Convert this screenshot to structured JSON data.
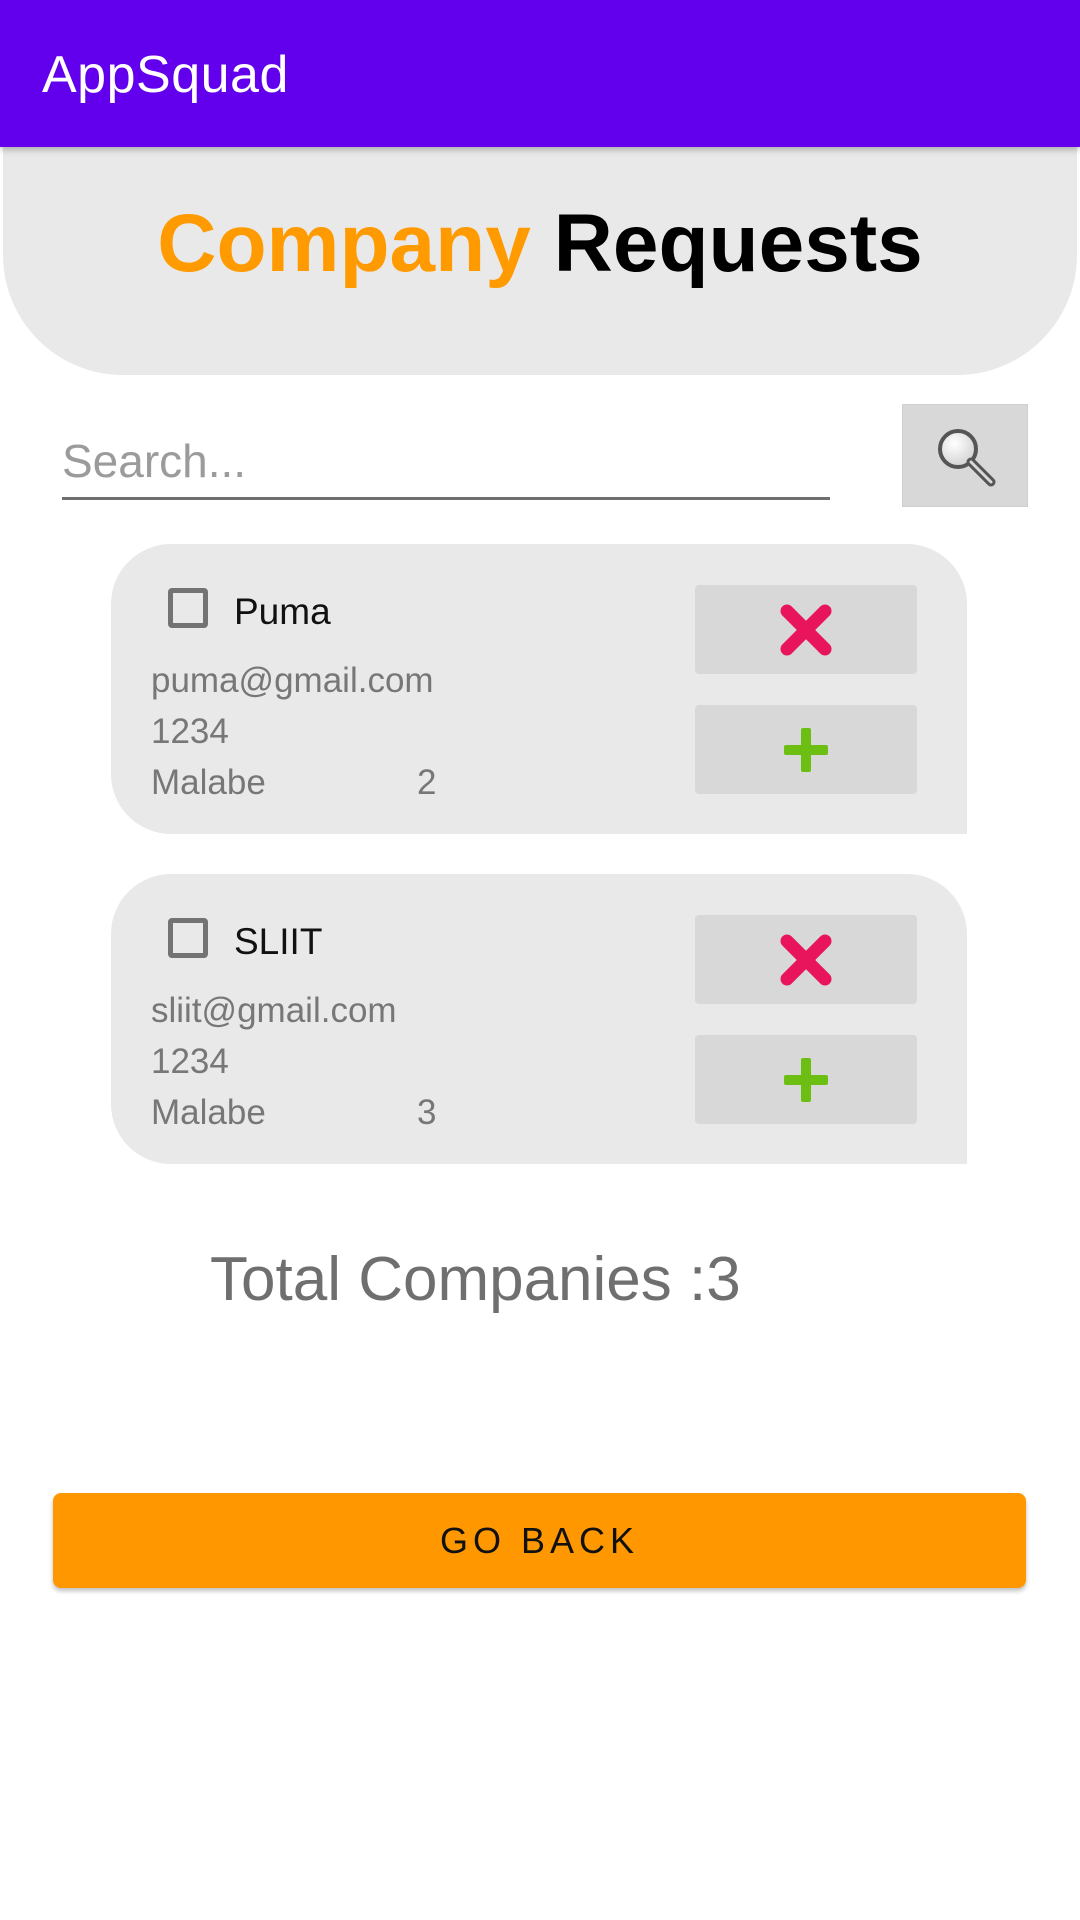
{
  "appbar": {
    "title": "AppSquad",
    "color": "#6200ee"
  },
  "header": {
    "title_word1": "Company",
    "title_word2": "Requests",
    "accent": "#ff9a00"
  },
  "search": {
    "placeholder": "Search...",
    "value": "",
    "icon": "search-icon"
  },
  "requests": [
    {
      "name": "Puma",
      "email": "puma@gmail.com",
      "phone": "1234",
      "location": "Malabe",
      "count": "2",
      "checked": false,
      "reject_icon": "close-icon",
      "accept_icon": "plus-icon"
    },
    {
      "name": "SLIIT",
      "email": "sliit@gmail.com",
      "phone": "1234",
      "location": "Malabe",
      "count": "3",
      "checked": false,
      "reject_icon": "close-icon",
      "accept_icon": "plus-icon"
    }
  ],
  "total": {
    "label": "Total Companies :3"
  },
  "go_back": {
    "label": "GO BACK",
    "color": "#ff9800"
  }
}
